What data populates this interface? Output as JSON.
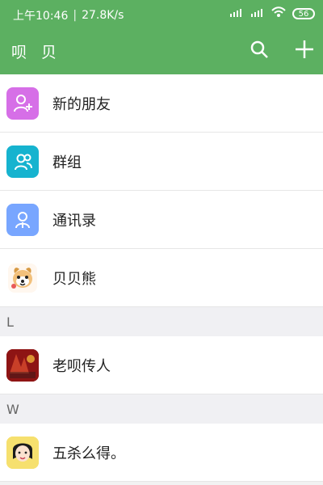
{
  "status_bar": {
    "time": "上午10:46",
    "separator": "|",
    "speed": "27.8K/s",
    "battery": "56",
    "icons": [
      "signal-icon",
      "signal-icon",
      "wifi-icon",
      "battery-icon"
    ]
  },
  "app_bar": {
    "title": "呗 贝",
    "actions": [
      "search-icon",
      "add-icon"
    ]
  },
  "items": [
    {
      "label": "新的朋友",
      "icon": "new-friend-icon",
      "color": "#d66fe7"
    },
    {
      "label": "群组",
      "icon": "group-icon",
      "color": "#16b3cf"
    },
    {
      "label": "通讯录",
      "icon": "contacts-icon",
      "color": "#78a6ff"
    },
    {
      "label": "贝贝熊",
      "icon": "dog-avatar"
    }
  ],
  "sections": [
    {
      "letter": "L",
      "items": [
        {
          "label": "老呗传人",
          "icon": "poster-avatar"
        }
      ]
    },
    {
      "letter": "W",
      "items": [
        {
          "label": "五杀么得。",
          "icon": "girl-avatar"
        }
      ]
    }
  ]
}
